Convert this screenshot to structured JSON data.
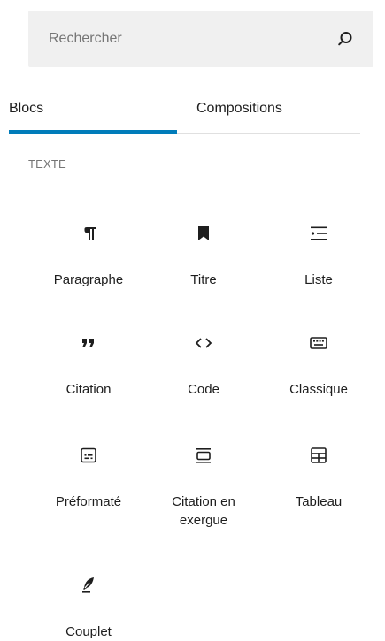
{
  "search": {
    "placeholder": "Rechercher"
  },
  "tabs": [
    {
      "label": "Blocs",
      "active": true
    },
    {
      "label": "Compositions",
      "active": false
    }
  ],
  "category": {
    "label": "TEXTE"
  },
  "blocks": [
    {
      "label": "Paragraphe",
      "icon": "paragraph-icon"
    },
    {
      "label": "Titre",
      "icon": "bookmark-icon"
    },
    {
      "label": "Liste",
      "icon": "list-icon"
    },
    {
      "label": "Citation",
      "icon": "quote-icon"
    },
    {
      "label": "Code",
      "icon": "code-icon"
    },
    {
      "label": "Classique",
      "icon": "keyboard-icon"
    },
    {
      "label": "Préformaté",
      "icon": "preformatted-icon"
    },
    {
      "label": "Citation en exergue",
      "icon": "pullquote-icon"
    },
    {
      "label": "Tableau",
      "icon": "table-icon"
    },
    {
      "label": "Couplet",
      "icon": "feather-icon"
    }
  ],
  "colors": {
    "accent": "#007cba",
    "search_bg": "#f0f0f0",
    "muted_text": "#757575",
    "text": "#1e1e1e"
  }
}
